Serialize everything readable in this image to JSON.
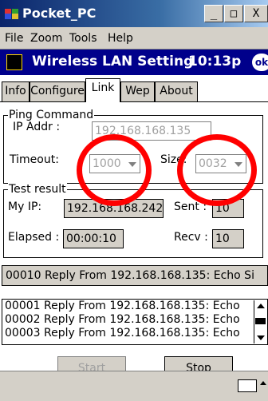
{
  "window": {
    "title": "Pocket_PC",
    "controls": {
      "minimize": "_",
      "maximize": "□",
      "close": "X"
    },
    "menu": [
      "File",
      "Zoom",
      "Tools",
      "Help"
    ]
  },
  "ppc": {
    "app_title": "Wireless LAN Setting",
    "time": "10:13p",
    "ok_label": "ok"
  },
  "tabs": [
    "Info",
    "Configure",
    "Link",
    "Wep",
    "About"
  ],
  "active_tab": "Link",
  "ping": {
    "legend": "Ping Command",
    "ip_label": "IP Addr :",
    "ip_value": "192.168.168.135",
    "timeout_label": "Timeout:",
    "timeout_value": "1000",
    "size_label": "Size:",
    "size_value": "0032"
  },
  "result": {
    "legend": "Test result",
    "my_ip_label": "My IP:",
    "my_ip_value": "192.168.168.242",
    "sent_label": "Sent :",
    "sent_value": "10",
    "elapsed_label": "Elapsed :",
    "elapsed_value": "00:00:10",
    "recv_label": "Recv :",
    "recv_value": "10"
  },
  "status_line": "00010 Reply From 192.168.168.135: Echo Si",
  "log": [
    "00001 Reply From 192.168.168.135: Echo",
    "00002 Reply From 192.168.168.135: Echo",
    "00003 Reply From 192.168.168.135: Echo"
  ],
  "buttons": {
    "start": "Start",
    "stop": "Stop"
  },
  "colors": {
    "annotation": "#ff0000",
    "ppc_nav": "#00008b"
  }
}
